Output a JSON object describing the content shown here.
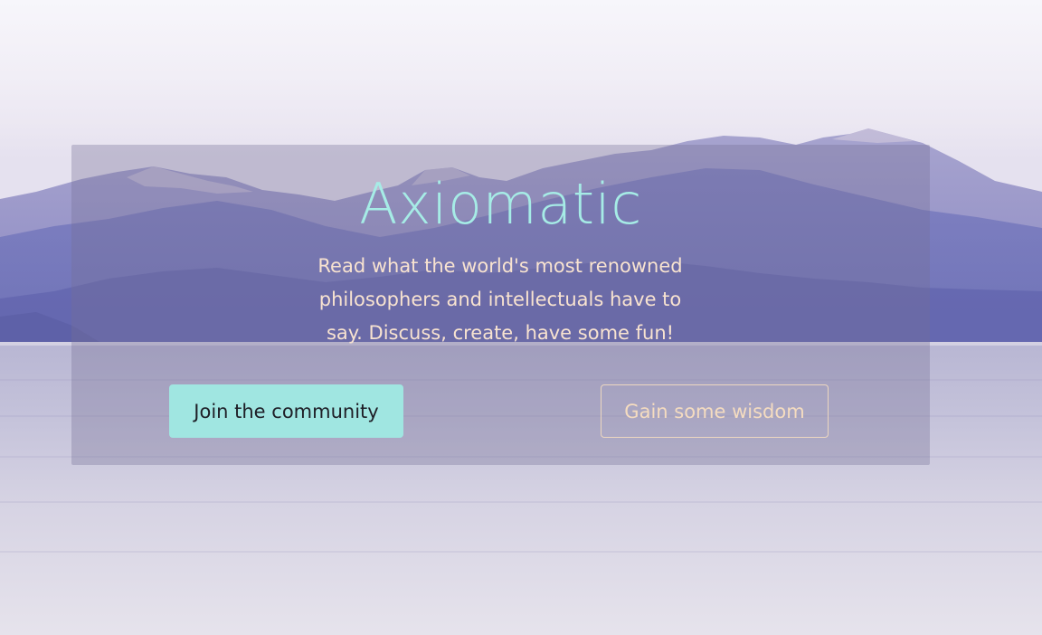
{
  "hero": {
    "title": "Axiomatic",
    "tagline": "Read what the world's most renowned philosophers and intellectuals have to say. Discuss, create, have some fun!"
  },
  "actions": {
    "join_label": "Join the community",
    "wisdom_label": "Gain some wisdom"
  },
  "colors": {
    "title": "#a6ece6",
    "tagline": "#f8e3d0",
    "primary_button": "#a0e6e1",
    "outline_button": "#f5dcc0"
  }
}
